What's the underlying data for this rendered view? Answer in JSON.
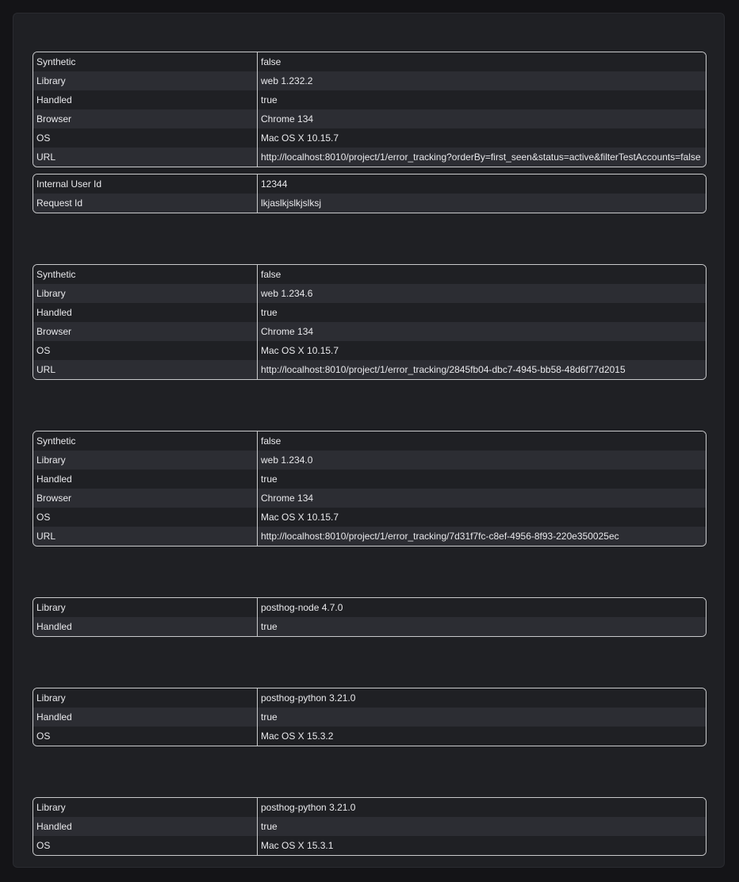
{
  "tables": [
    {
      "rows": [
        {
          "key": "Synthetic",
          "value": "false"
        },
        {
          "key": "Library",
          "value": "web 1.232.2"
        },
        {
          "key": "Handled",
          "value": "true"
        },
        {
          "key": "Browser",
          "value": "Chrome 134"
        },
        {
          "key": "OS",
          "value": "Mac OS X 10.15.7"
        },
        {
          "key": "URL",
          "value": "http://localhost:8010/project/1/error_tracking?orderBy=first_seen&status=active&filterTestAccounts=false"
        }
      ]
    },
    {
      "rows": [
        {
          "key": "Internal User Id",
          "value": "12344"
        },
        {
          "key": "Request Id",
          "value": "lkjaslkjslkjslksj"
        }
      ]
    },
    {
      "rows": [
        {
          "key": "Synthetic",
          "value": "false"
        },
        {
          "key": "Library",
          "value": "web 1.234.6"
        },
        {
          "key": "Handled",
          "value": "true"
        },
        {
          "key": "Browser",
          "value": "Chrome 134"
        },
        {
          "key": "OS",
          "value": "Mac OS X 10.15.7"
        },
        {
          "key": "URL",
          "value": "http://localhost:8010/project/1/error_tracking/2845fb04-dbc7-4945-bb58-48d6f77d2015"
        }
      ]
    },
    {
      "rows": [
        {
          "key": "Synthetic",
          "value": "false"
        },
        {
          "key": "Library",
          "value": "web 1.234.0"
        },
        {
          "key": "Handled",
          "value": "true"
        },
        {
          "key": "Browser",
          "value": "Chrome 134"
        },
        {
          "key": "OS",
          "value": "Mac OS X 10.15.7"
        },
        {
          "key": "URL",
          "value": "http://localhost:8010/project/1/error_tracking/7d31f7fc-c8ef-4956-8f93-220e350025ec"
        }
      ]
    },
    {
      "rows": [
        {
          "key": "Library",
          "value": "posthog-node 4.7.0"
        },
        {
          "key": "Handled",
          "value": "true"
        }
      ]
    },
    {
      "rows": [
        {
          "key": "Library",
          "value": "posthog-python 3.21.0"
        },
        {
          "key": "Handled",
          "value": "true"
        },
        {
          "key": "OS",
          "value": "Mac OS X 15.3.2"
        }
      ]
    },
    {
      "rows": [
        {
          "key": "Library",
          "value": "posthog-python 3.21.0"
        },
        {
          "key": "Handled",
          "value": "true"
        },
        {
          "key": "OS",
          "value": "Mac OS X 15.3.1"
        }
      ]
    }
  ]
}
